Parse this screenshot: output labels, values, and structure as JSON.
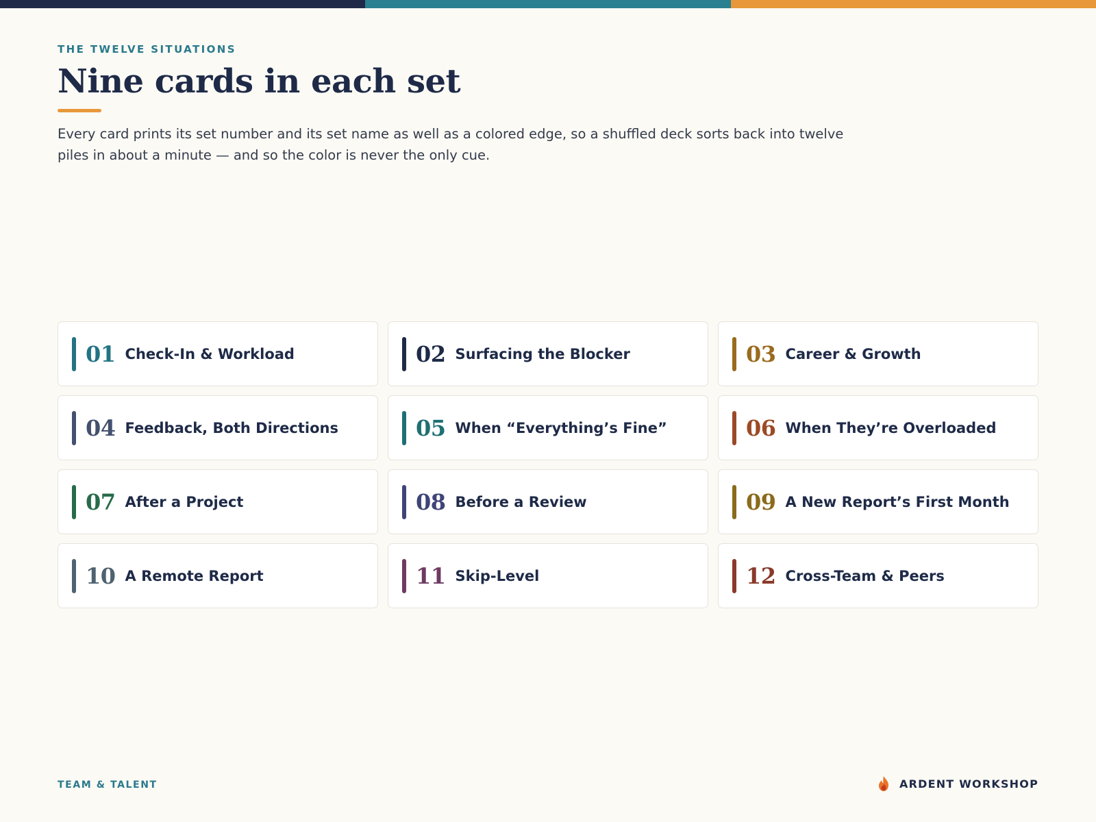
{
  "colors": {
    "bar_navy": "#1e2a47",
    "bar_teal": "#2a8090",
    "bar_orange": "#e8983a",
    "accent": "#e8983a"
  },
  "header": {
    "eyebrow": "THE TWELVE SITUATIONS",
    "title": "Nine cards in each set",
    "intro": "Every card prints its set number and its set name as well as a colored edge, so a shuffled deck sorts back into twelve piles in about a minute — and so the color is never the only cue."
  },
  "sets": [
    {
      "num": "01",
      "name": "Check-In & Workload",
      "color": "#227483"
    },
    {
      "num": "02",
      "name": "Surfacing the Blocker",
      "color": "#1e2a47"
    },
    {
      "num": "03",
      "name": "Career & Growth",
      "color": "#9a6a1e"
    },
    {
      "num": "04",
      "name": "Feedback, Both Directions",
      "color": "#43506e"
    },
    {
      "num": "05",
      "name": "When “Everything’s Fine”",
      "color": "#1e6f73"
    },
    {
      "num": "06",
      "name": "When They’re Overloaded",
      "color": "#9b4a26"
    },
    {
      "num": "07",
      "name": "After a Project",
      "color": "#286b4a"
    },
    {
      "num": "08",
      "name": "Before a Review",
      "color": "#3f4478"
    },
    {
      "num": "09",
      "name": "A New Report’s First Month",
      "color": "#8a6a1c"
    },
    {
      "num": "10",
      "name": "A Remote Report",
      "color": "#4f6270"
    },
    {
      "num": "11",
      "name": "Skip-Level",
      "color": "#6e3a62"
    },
    {
      "num": "12",
      "name": "Cross-Team & Peers",
      "color": "#8a3a2a"
    }
  ],
  "footer": {
    "left": "TEAM & TALENT",
    "brand": "ARDENT WORKSHOP",
    "brand_icon": "flame-icon"
  }
}
